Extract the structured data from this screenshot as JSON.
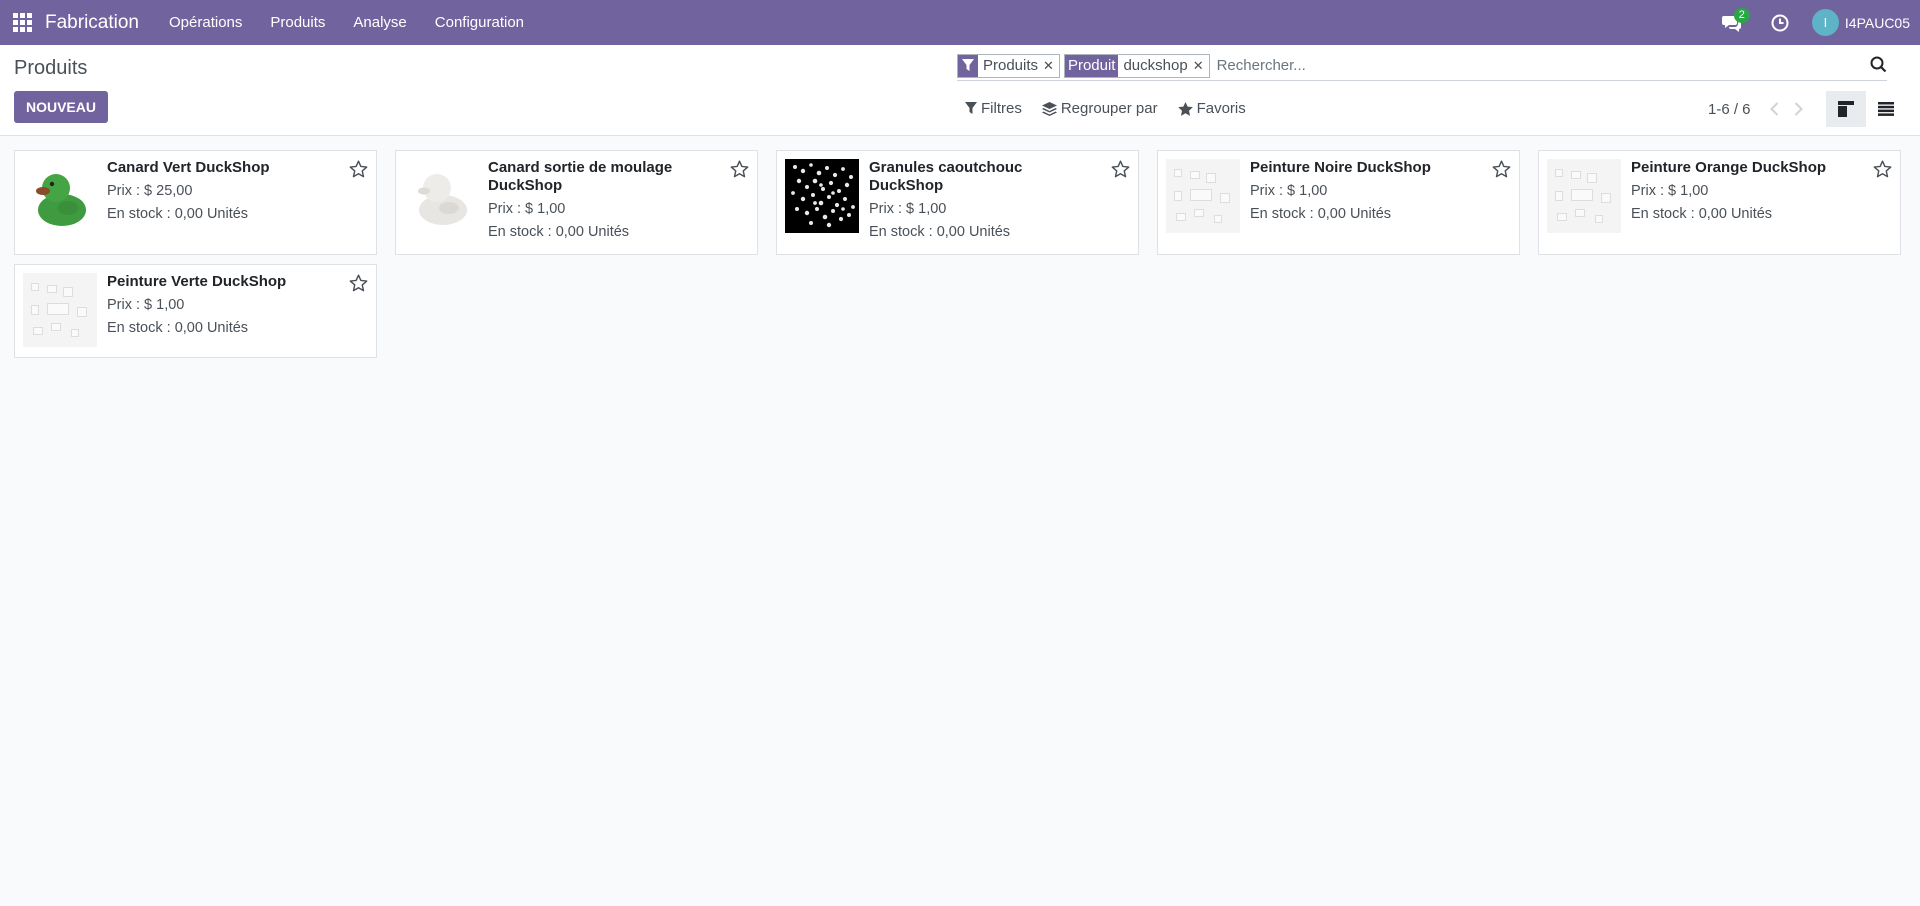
{
  "navbar": {
    "brand": "Fabrication",
    "menu": [
      "Opérations",
      "Produits",
      "Analyse",
      "Configuration"
    ],
    "chat_count": "2",
    "avatar_letter": "I",
    "username": "I4PAUC05",
    "color": "#71639e"
  },
  "control_panel": {
    "title": "Produits",
    "new_button": "NOUVEAU",
    "search": {
      "facets": [
        {
          "tag": "filter-icon",
          "value": "Produits"
        },
        {
          "tag": "Produit",
          "value": "duckshop"
        }
      ],
      "placeholder": "Rechercher..."
    },
    "filters_label": "Filtres",
    "group_label": "Regrouper par",
    "favorites_label": "Favoris",
    "pager": "1-6 / 6"
  },
  "products": [
    {
      "name": "Canard Vert DuckShop",
      "price": "Prix : $ 25,00",
      "stock": "En stock : 0,00 Unités",
      "image": "green-duck"
    },
    {
      "name": "Canard sortie de moulage DuckShop",
      "price": "Prix : $ 1,00",
      "stock": "En stock : 0,00 Unités",
      "image": "white-duck"
    },
    {
      "name": "Granules caoutchouc DuckShop",
      "price": "Prix : $ 1,00",
      "stock": "En stock : 0,00 Unités",
      "image": "granules"
    },
    {
      "name": "Peinture Noire DuckShop",
      "price": "Prix : $ 1,00",
      "stock": "En stock : 0,00 Unités",
      "image": "placeholder"
    },
    {
      "name": "Peinture Orange DuckShop",
      "price": "Prix : $ 1,00",
      "stock": "En stock : 0,00 Unités",
      "image": "placeholder"
    },
    {
      "name": "Peinture Verte DuckShop",
      "price": "Prix : $ 1,00",
      "stock": "En stock : 0,00 Unités",
      "image": "placeholder"
    }
  ]
}
